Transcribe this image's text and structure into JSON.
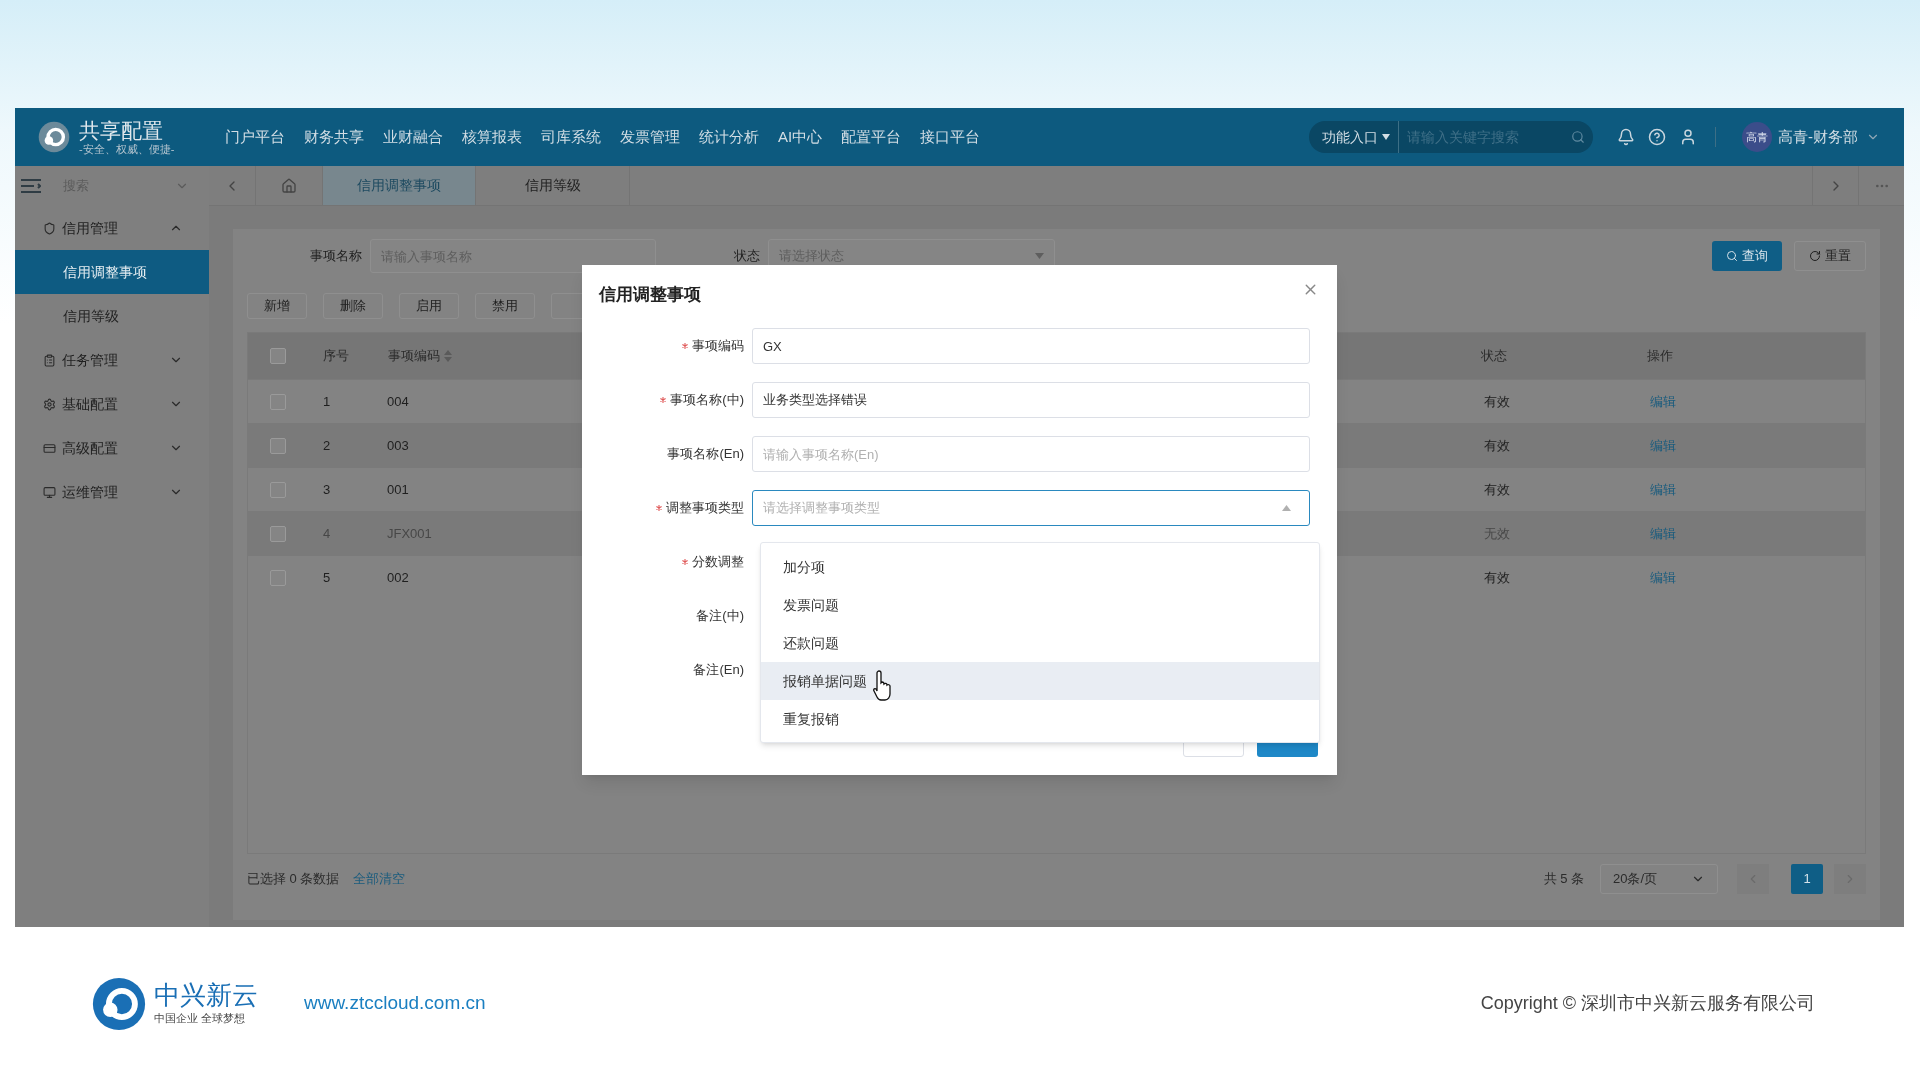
{
  "header": {
    "logo_title": "共享配置",
    "logo_subtitle": "-安全、权威、便捷-",
    "nav": [
      "门户平台",
      "财务共享",
      "业财融合",
      "核算报表",
      "司库系统",
      "发票管理",
      "统计分析",
      "AI中心",
      "配置平台",
      "接口平台"
    ],
    "function_entry": "功能入口",
    "search_placeholder": "请输入关键字搜索",
    "user": {
      "avatar_text": "高青",
      "name": "高青-财务部"
    }
  },
  "sidebar": {
    "search_placeholder": "搜索",
    "items": [
      {
        "label": "信用管理",
        "expanded": true,
        "children": [
          {
            "label": "信用调整事项",
            "selected": true
          },
          {
            "label": "信用等级",
            "selected": false
          }
        ]
      },
      {
        "label": "任务管理",
        "expanded": false
      },
      {
        "label": "基础配置",
        "expanded": false
      },
      {
        "label": "高级配置",
        "expanded": false
      },
      {
        "label": "运维管理",
        "expanded": false
      }
    ]
  },
  "tabs": [
    {
      "label": "信用调整事项",
      "selected": true
    },
    {
      "label": "信用等级",
      "selected": false
    }
  ],
  "filter": {
    "fields": [
      {
        "kind": "input",
        "label": "事项名称",
        "placeholder": "请输入事项名称"
      },
      {
        "kind": "select",
        "label": "状态",
        "placeholder": "请选择状态"
      }
    ],
    "buttons": [
      {
        "kind": "primary",
        "label": "查询"
      },
      {
        "kind": "default",
        "label": "重置"
      }
    ]
  },
  "toolbar": [
    "新增",
    "删除",
    "启用",
    "禁用"
  ],
  "table": {
    "select_all_checked": false,
    "columns": [
      {
        "label": "序号",
        "sortable": false
      },
      {
        "label": "事项编码",
        "sortable": true
      },
      {
        "label": "状态",
        "sortable": false
      },
      {
        "label": "操作",
        "sortable": false
      }
    ],
    "rows": [
      {
        "checked": false,
        "disabled": false,
        "index": "1",
        "code": "004",
        "status": "有效",
        "action": "编辑"
      },
      {
        "checked": false,
        "disabled": false,
        "index": "2",
        "code": "003",
        "status": "有效",
        "action": "编辑"
      },
      {
        "checked": false,
        "disabled": false,
        "index": "3",
        "code": "001",
        "status": "有效",
        "action": "编辑"
      },
      {
        "checked": false,
        "disabled": true,
        "index": "4",
        "code": "JFX001",
        "status": "无效",
        "action": "编辑"
      },
      {
        "checked": false,
        "disabled": false,
        "index": "5",
        "code": "002",
        "status": "有效",
        "action": "编辑"
      }
    ]
  },
  "selection": {
    "text": "已选择 0 条数据",
    "clear_link": "全部清空"
  },
  "pagination": {
    "total": "共 5 条",
    "page_size": "20条/页",
    "pages": [
      {
        "label": "1",
        "selected": true
      }
    ]
  },
  "modal": {
    "title": "信用调整事项",
    "fields": [
      {
        "kind": "input",
        "label": "事项编码",
        "required": true,
        "value": "GX"
      },
      {
        "kind": "input",
        "label": "事项名称(中)",
        "required": true,
        "value": "业务类型选择错误"
      },
      {
        "kind": "input",
        "label": "事项名称(En)",
        "required": false,
        "placeholder": "请输入事项名称(En)"
      },
      {
        "kind": "select",
        "label": "调整事项类型",
        "required": true,
        "placeholder": "请选择调整事项类型",
        "expanded": true
      },
      {
        "kind": "covered",
        "label": "分数调整",
        "required": true
      },
      {
        "kind": "covered",
        "label": "备注(中)",
        "required": false
      },
      {
        "kind": "covered",
        "label": "备注(En)",
        "required": false
      }
    ],
    "dropdown": [
      {
        "label": "加分项",
        "hovered": false
      },
      {
        "label": "发票问题",
        "hovered": false
      },
      {
        "label": "还款问题",
        "hovered": false
      },
      {
        "label": "报销单据问题",
        "hovered": true
      },
      {
        "label": "重复报销",
        "hovered": false
      }
    ]
  },
  "footer": {
    "brand": "中兴新云",
    "brand_subtitle": "中国企业 全球梦想",
    "url": "www.ztccloud.com.cn",
    "copyright": "Copyright © 深圳市中兴新云服务有限公司"
  }
}
